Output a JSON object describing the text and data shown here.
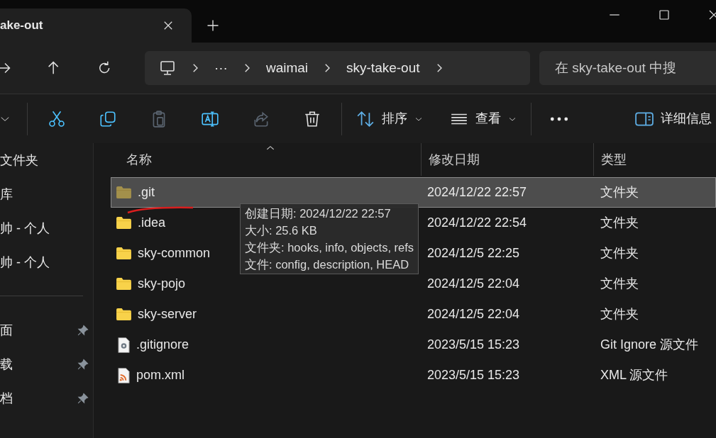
{
  "tab": {
    "title": "ake-out"
  },
  "address": {
    "segments": [
      "···",
      "waimai",
      "sky-take-out"
    ]
  },
  "search": {
    "placeholder": "在 sky-take-out 中搜"
  },
  "toolbar": {
    "actions": [
      {
        "kind": "cut",
        "disabled": false
      },
      {
        "kind": "copy",
        "disabled": false
      },
      {
        "kind": "paste",
        "disabled": true
      },
      {
        "kind": "rename",
        "disabled": false
      },
      {
        "kind": "share",
        "disabled": true
      },
      {
        "kind": "delete",
        "disabled": false
      }
    ],
    "sort": "排序",
    "view": "查看",
    "details": "详细信息"
  },
  "sidebar": {
    "items": [
      {
        "label": "文件夹",
        "pinned": false
      },
      {
        "label": "库",
        "pinned": false
      },
      {
        "label": "帅 - 个人",
        "pinned": false
      },
      {
        "label": "帅 - 个人",
        "pinned": false
      },
      {
        "label": "面",
        "pinned": true
      },
      {
        "label": "载",
        "pinned": true
      },
      {
        "label": "档",
        "pinned": true
      }
    ]
  },
  "table": {
    "columns": [
      "名称",
      "修改日期",
      "类型"
    ],
    "rows": [
      {
        "name": ".git",
        "kind": "folder",
        "hidden": true,
        "selected": true,
        "date": "2024/12/22 22:57",
        "type": "文件夹"
      },
      {
        "name": ".idea",
        "kind": "folder",
        "hidden": false,
        "selected": false,
        "date": "2024/12/22 22:54",
        "type": "文件夹"
      },
      {
        "name": "sky-common",
        "kind": "folder",
        "hidden": false,
        "selected": false,
        "date": "2024/12/5 22:25",
        "type": "文件夹"
      },
      {
        "name": "sky-pojo",
        "kind": "folder",
        "hidden": false,
        "selected": false,
        "date": "2024/12/5 22:04",
        "type": "文件夹"
      },
      {
        "name": "sky-server",
        "kind": "folder",
        "hidden": false,
        "selected": false,
        "date": "2024/12/5 22:04",
        "type": "文件夹"
      },
      {
        "name": ".gitignore",
        "kind": "settings-file",
        "hidden": false,
        "selected": false,
        "date": "2023/5/15 15:23",
        "type": "Git Ignore 源文件"
      },
      {
        "name": "pom.xml",
        "kind": "feed-file",
        "hidden": false,
        "selected": false,
        "date": "2023/5/15 15:23",
        "type": "XML 源文件"
      }
    ]
  },
  "tooltip": {
    "lines": [
      "创建日期: 2024/12/22 22:57",
      "大小: 25.6 KB",
      "文件夹: hooks, info, objects, refs",
      "文件: config, description, HEAD"
    ]
  }
}
